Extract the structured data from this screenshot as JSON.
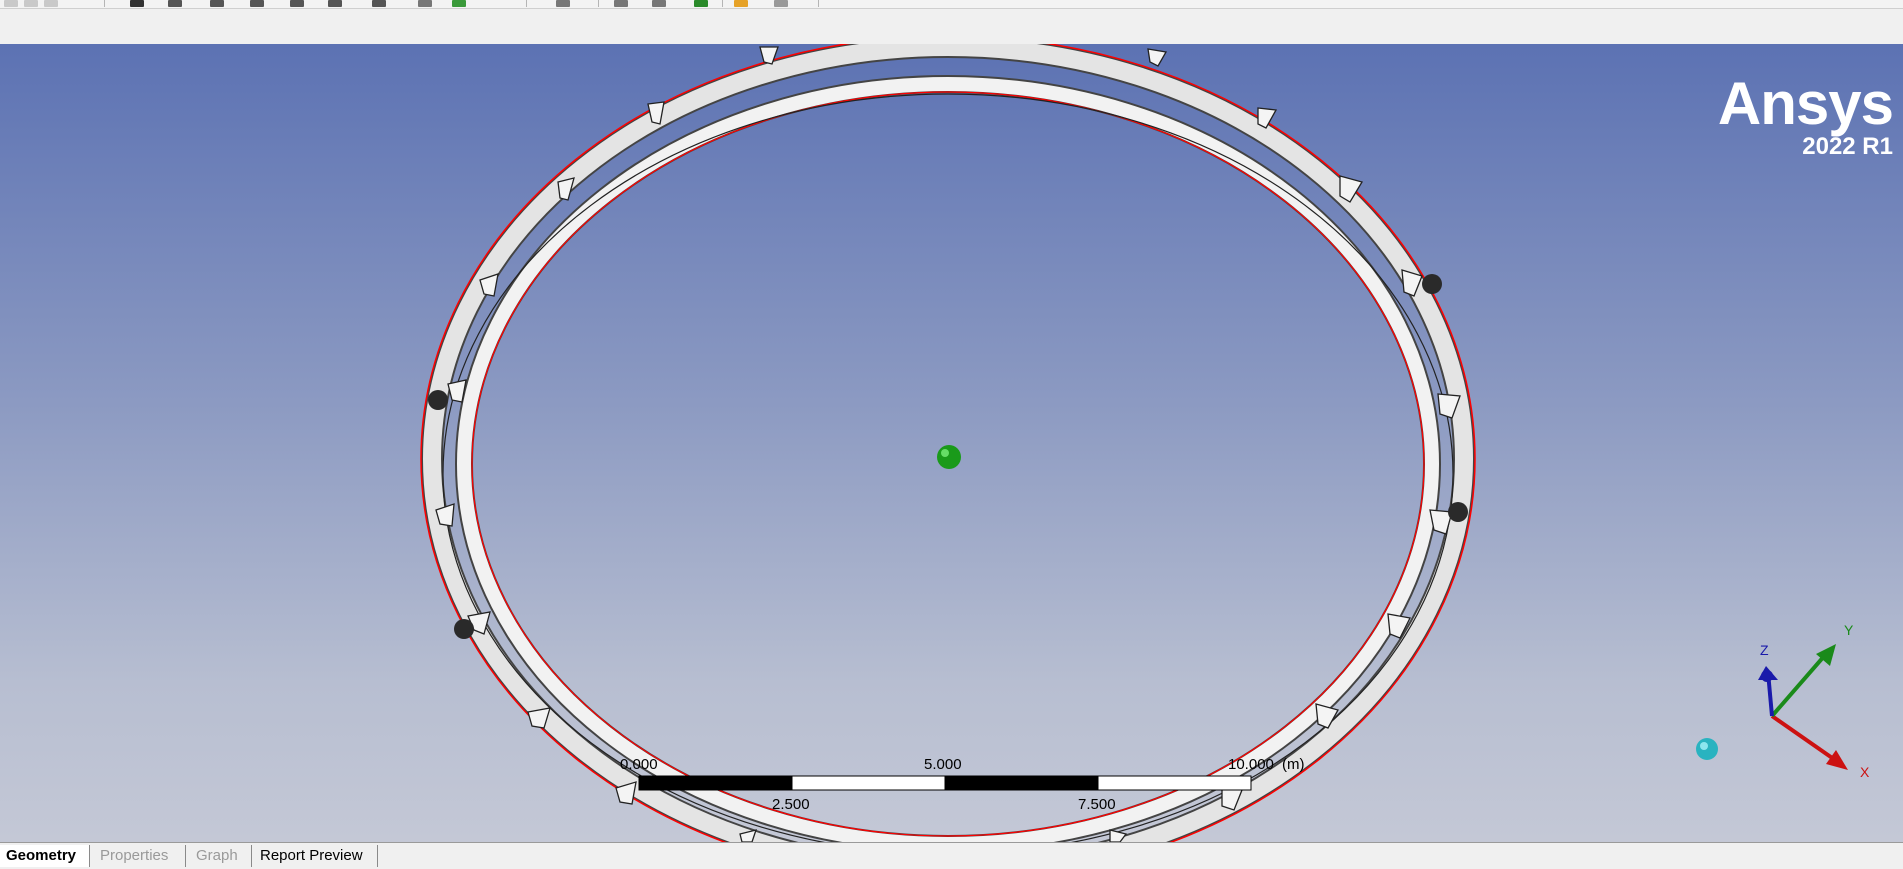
{
  "brand": {
    "name": "Ansys",
    "version": "2022 R1"
  },
  "scale_bar": {
    "unit": "(m)",
    "top_labels": [
      "0.000",
      "5.000",
      "10.000"
    ],
    "bottom_labels": [
      "2.500",
      "7.500"
    ]
  },
  "triad": {
    "x_label": "X",
    "y_label": "Y",
    "z_label": "Z"
  },
  "tabs": [
    {
      "label": "Geometry",
      "state": "active"
    },
    {
      "label": "Properties",
      "state": "disabled"
    },
    {
      "label": "Graph",
      "state": "disabled"
    },
    {
      "label": "Report Preview",
      "state": "normal"
    }
  ],
  "colors": {
    "background_top": "#5c72b3",
    "background_bottom": "#c4c8d6",
    "edge_highlight": "#ff0000",
    "center_point": "#1a9a1a",
    "x_axis": "#cc1111",
    "y_axis": "#1a8a1a",
    "z_axis": "#1a1aaa"
  }
}
